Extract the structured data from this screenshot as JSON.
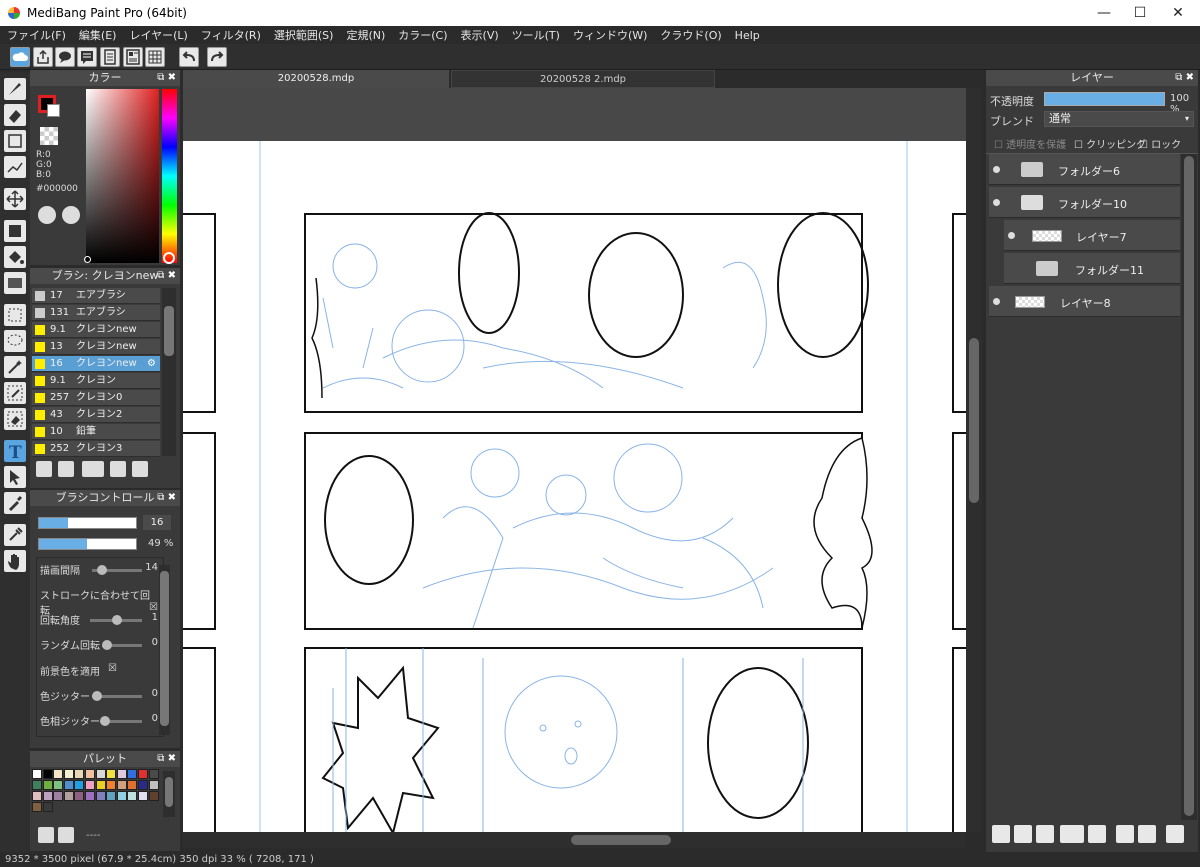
{
  "window": {
    "title": "MediBang Paint Pro (64bit)"
  },
  "menu": [
    "ファイル(F)",
    "編集(E)",
    "レイヤー(L)",
    "フィルタ(R)",
    "選択範囲(S)",
    "定規(N)",
    "カラー(C)",
    "表示(V)",
    "ツール(T)",
    "ウィンドウ(W)",
    "クラウド(O)",
    "Help"
  ],
  "tabs": [
    {
      "label": "20200528.mdp",
      "active": true
    },
    {
      "label": "20200528 2.mdp",
      "active": false
    }
  ],
  "color_panel": {
    "title": "カラー",
    "rgb": {
      "r": "R:0",
      "g": "G:0",
      "b": "B:0"
    },
    "hex": "#000000"
  },
  "brush_panel": {
    "title": "ブラシ: クレヨンnew",
    "items": [
      {
        "size": "17",
        "name": "エアブラシ",
        "color": "#cccccc",
        "selected": false
      },
      {
        "size": "131",
        "name": "エアブラシ",
        "color": "#cccccc",
        "selected": false
      },
      {
        "size": "9.1",
        "name": "クレヨンnew",
        "color": "#ffee00",
        "selected": false
      },
      {
        "size": "13",
        "name": "クレヨンnew",
        "color": "#ffee00",
        "selected": false
      },
      {
        "size": "16",
        "name": "クレヨンnew",
        "color": "#ffee00",
        "selected": true
      },
      {
        "size": "9.1",
        "name": "クレヨン",
        "color": "#ffee00",
        "selected": false
      },
      {
        "size": "257",
        "name": "クレヨン0",
        "color": "#ffee00",
        "selected": false
      },
      {
        "size": "43",
        "name": "クレヨン2",
        "color": "#ffee00",
        "selected": false
      },
      {
        "size": "10",
        "name": "鉛筆",
        "color": "#ffee00",
        "selected": false
      },
      {
        "size": "252",
        "name": "クレヨン3",
        "color": "#ffee00",
        "selected": false
      }
    ]
  },
  "brush_control": {
    "title": "ブラシコントロール",
    "size_value": "16",
    "opacity_value": "49 %",
    "size_fraction": 0.3,
    "opacity_fraction": 0.49,
    "rows": [
      {
        "label": "描画間隔",
        "value": "14"
      },
      {
        "label": "ストロークに合わせて回転",
        "value": "☒"
      },
      {
        "label": "回転角度",
        "value": "1"
      },
      {
        "label": "ランダム回転",
        "value": "0"
      },
      {
        "label": "前景色を適用",
        "value": "☒"
      },
      {
        "label": "色ジッター",
        "value": "0"
      },
      {
        "label": "色相ジッター",
        "value": "0"
      }
    ]
  },
  "palette_panel": {
    "title": "パレット",
    "footer": "----",
    "colors": [
      "#ffffff",
      "#000000",
      "#f7e7c9",
      "#f5f0d0",
      "#e8d8b8",
      "#f0c0a0",
      "#d8d8d8",
      "#f0e040",
      "#e0c8e0",
      "#3070e0",
      "#e03030",
      "#4a4a4a",
      "#408060",
      "#70b040",
      "#80c080",
      "#5090d0",
      "#20a0e0",
      "#f0a0c0",
      "#e8d020",
      "#f08030",
      "#d0a080",
      "#e07030",
      "#2a2a8a",
      "#c0c0c0",
      "#e0c0c0",
      "#c0a0c0",
      "#a080a0",
      "#b0a0a0",
      "#906080",
      "#a070c0",
      "#8080c0",
      "#60a0c0",
      "#90d0e0",
      "#c0e0e0",
      "#e0e0f0",
      "#604030",
      "#806040",
      "#3a3a3a"
    ]
  },
  "layer_panel": {
    "title": "レイヤー",
    "opacity_label": "不透明度",
    "opacity_value": "100 %",
    "blend_label": "ブレンド",
    "blend_value": "通常",
    "protect_label": "透明度を保護",
    "clipping_label": "クリッピング",
    "lock_label": "ロック",
    "layers": [
      {
        "name": "フォルダー6",
        "type": "folder"
      },
      {
        "name": "フォルダー10",
        "type": "folder-open"
      },
      {
        "name": "レイヤー7",
        "type": "layer"
      },
      {
        "name": "フォルダー11",
        "type": "folder"
      },
      {
        "name": "レイヤー8",
        "type": "layer"
      }
    ]
  },
  "status_bar": "9352 * 3500 pixel  (67.9 * 25.4cm)  350 dpi  33 %  ( 7208, 171 )",
  "colors": {
    "accent": "#5a9fd4",
    "bg": "#2b2b2b",
    "panel": "#3a3a3a"
  }
}
